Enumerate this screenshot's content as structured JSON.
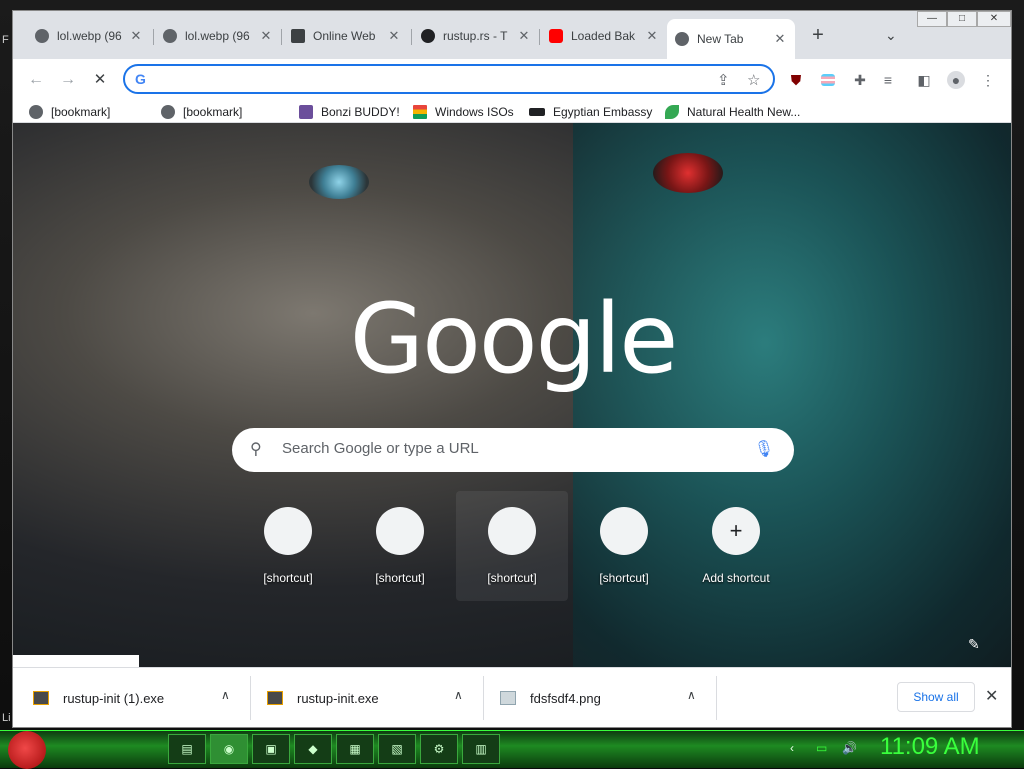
{
  "tabs": [
    {
      "label": "lol.webp (96",
      "favicon_color": "#5f6368"
    },
    {
      "label": "lol.webp (96",
      "favicon_color": "#5f6368"
    },
    {
      "label": "Online Web",
      "favicon_color": "#3c4043"
    },
    {
      "label": "rustup.rs - T",
      "favicon_color": "#202124"
    },
    {
      "label": "Loaded Bak",
      "favicon_color": "#ff0000"
    },
    {
      "label": "New Tab",
      "favicon_color": "#5f6368",
      "active": true
    }
  ],
  "window_controls": {
    "minimize": "—",
    "maximize": "□",
    "close": "✕"
  },
  "omnibox": {
    "value": "",
    "icon": "google-g-icon",
    "g_glyph": "G"
  },
  "bookmarks": [
    {
      "label": "[bookmark]",
      "icon_color": "#5f6368"
    },
    {
      "label": "[bookmark]",
      "icon_color": "#5f6368"
    },
    {
      "label": "Bonzi BUDDY!",
      "icon_color": "#6b4e9b"
    },
    {
      "label": "Windows ISOs",
      "icon_color": "#e8453c"
    },
    {
      "label": "Egyptian Embassy",
      "icon_color": "#202124"
    },
    {
      "label": "Natural Health New...",
      "icon_color": "#34a853"
    }
  ],
  "ntp": {
    "logo": "Google",
    "search_placeholder": "Search Google or type a URL",
    "shortcuts": [
      {
        "label": "[shortcut]",
        "icon_text": "",
        "icon_color": "#9aa0a6"
      },
      {
        "label": "[shortcut]",
        "icon_text": "",
        "icon_color": "#9aa0a6"
      },
      {
        "label": "[shortcut]",
        "icon_text": "",
        "icon_color": "#9aa0a6"
      },
      {
        "label": "[shortcut]",
        "icon_text": "",
        "icon_color": "#9aa0a6"
      },
      {
        "label": "Add shortcut",
        "icon_text": "+",
        "icon_color": "#202124"
      }
    ]
  },
  "downloads": {
    "items": [
      {
        "filename": "rustup-init (1).exe"
      },
      {
        "filename": "rustup-init.exe"
      },
      {
        "filename": "fdsfsdf4.png"
      }
    ],
    "show_all_label": "Show all"
  },
  "taskbar": {
    "clock": "11:09 AM",
    "accent_color": "#39ff3c"
  },
  "desktop": {
    "left_edge_text_top": "F",
    "left_edge_text_bottom": "Li"
  }
}
